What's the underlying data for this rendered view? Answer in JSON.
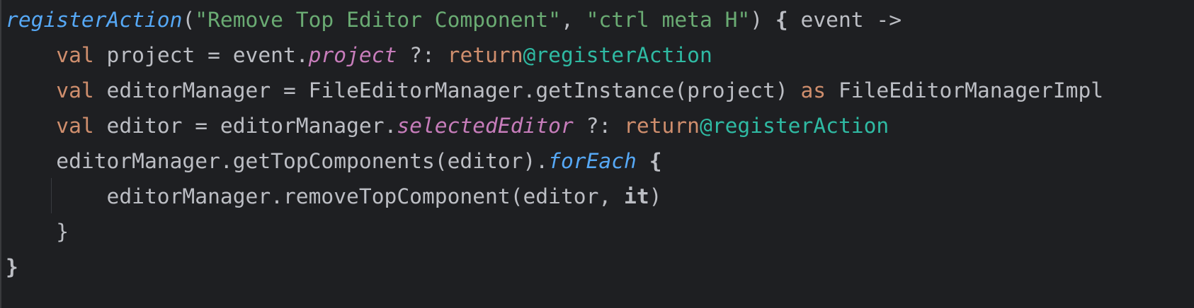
{
  "editor": {
    "colors": {
      "background": "#1e1f22",
      "keyword": "#cf8e6d",
      "string": "#6aab73",
      "function": "#56a8f5",
      "property": "#c77dbb",
      "label": "#2fbaa3",
      "text": "#bcbec4"
    },
    "lines": [
      [
        [
          "registerAction",
          "fn"
        ],
        [
          "(",
          "plain"
        ],
        [
          "\"Remove Top Editor Component\"",
          "str"
        ],
        [
          ", ",
          "plain"
        ],
        [
          "\"ctrl meta H\"",
          "str"
        ],
        [
          ") ",
          "plain"
        ],
        [
          "{",
          "bold"
        ],
        [
          " event ->",
          "plain"
        ]
      ],
      [
        [
          "    ",
          "plain"
        ],
        [
          "val",
          "kw"
        ],
        [
          " project = event.",
          "plain"
        ],
        [
          "project",
          "prop"
        ],
        [
          " ?: ",
          "plain"
        ],
        [
          "return",
          "kw"
        ],
        [
          "@registerAction",
          "label"
        ]
      ],
      [
        [
          "    ",
          "plain"
        ],
        [
          "val",
          "kw"
        ],
        [
          " editorManager = FileEditorManager.getInstance(project) ",
          "plain"
        ],
        [
          "as",
          "kw"
        ],
        [
          " FileEditorManagerImpl",
          "plain"
        ]
      ],
      [
        [
          "    ",
          "plain"
        ],
        [
          "val",
          "kw"
        ],
        [
          " editor = editorManager.",
          "plain"
        ],
        [
          "selectedEditor",
          "prop"
        ],
        [
          " ?: ",
          "plain"
        ],
        [
          "return",
          "kw"
        ],
        [
          "@registerAction",
          "label"
        ]
      ],
      [
        [
          "    editorManager.getTopComponents(editor).",
          "plain"
        ],
        [
          "forEach",
          "fn"
        ],
        [
          " ",
          "plain"
        ],
        [
          "{",
          "bold"
        ]
      ],
      [
        [
          "        editorManager.removeTopComponent(editor, ",
          "plain"
        ],
        [
          "it",
          "bold"
        ],
        [
          ")",
          "plain"
        ]
      ],
      [
        [
          "    }",
          "plain"
        ]
      ],
      [
        [
          "}",
          "bold"
        ]
      ]
    ]
  }
}
